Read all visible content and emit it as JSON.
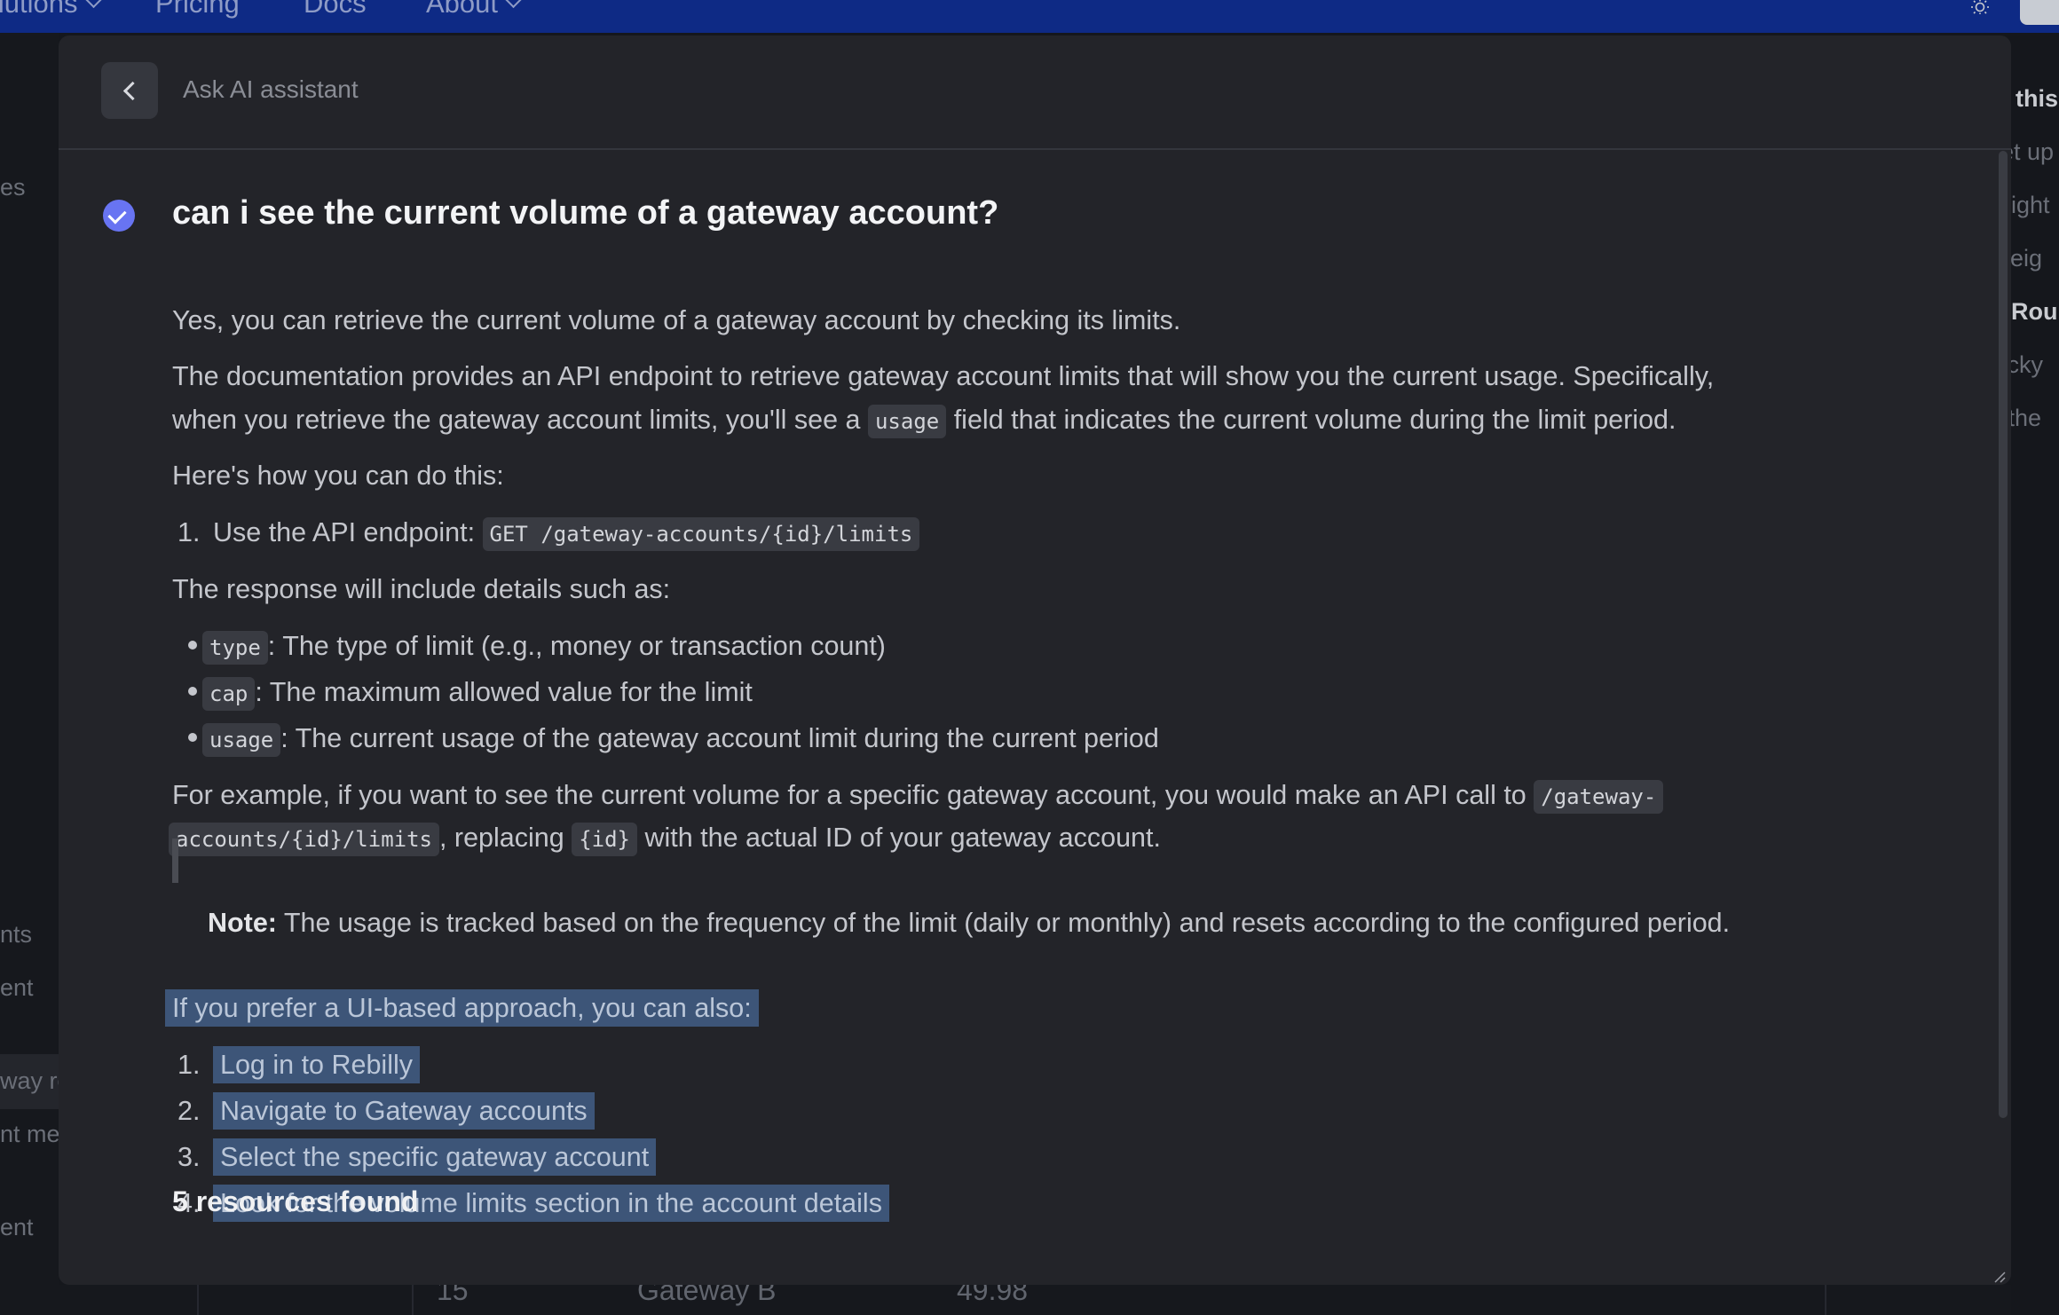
{
  "nav": {
    "solutions_label": "Solutions",
    "pricing_label": "Pricing",
    "docs_label": "Docs",
    "about_label": "About"
  },
  "background": {
    "left_fragments": [
      "es",
      "nts",
      "ent",
      "way ro",
      "nt me",
      "ent"
    ],
    "right_fragments": [
      "On this",
      "Set up",
      "Weight",
      "Weig",
      "Rou",
      "Sticky",
      "Furthe"
    ],
    "table_row": {
      "id": "15",
      "name": "Gateway B",
      "value": "49.98"
    }
  },
  "modal": {
    "header_title": "Ask AI assistant",
    "question": "can i see the current volume of a gateway account?",
    "answer": {
      "intro": "Yes, you can retrieve the current volume of a gateway account by checking its limits.",
      "doc_line1": "The documentation provides an API endpoint to retrieve gateway account limits that will show you the current usage. Specifically,",
      "doc_line2_a": "when you retrieve the gateway account limits, you'll see a ",
      "doc_line2_code": "usage",
      "doc_line2_b": " field that indicates the current volume during the limit period.",
      "howto": "Here's how you can do this:",
      "step1_num": "1.",
      "step1_text": "Use the API endpoint: ",
      "step1_code": "GET /gateway-accounts/{id}/limits",
      "response_intro": "The response will include details such as:",
      "details": [
        {
          "code": "type",
          "text": ": The type of limit (e.g., money or transaction count)"
        },
        {
          "code": "cap",
          "text": ": The maximum allowed value for the limit"
        },
        {
          "code": "usage",
          "text": ": The current usage of the gateway account limit during the current period"
        }
      ],
      "example_line1_a": "For example, if you want to see the current volume for a specific gateway account, you would make an API call to ",
      "example_line1_code": "/gateway-",
      "example_line2_code": "accounts/{id}/limits",
      "example_line2_b": ", replacing ",
      "example_line2_code2": "{id}",
      "example_line2_c": " with the actual ID of your gateway account.",
      "note_label": "Note:",
      "note_text": " The usage is tracked based on the frequency of the limit (daily or monthly) and resets according to the configured period.",
      "ui_intro": "If you prefer a UI-based approach, you can also:",
      "ui_steps": [
        {
          "num": "1.",
          "text": "Log in to Rebilly"
        },
        {
          "num": "2.",
          "text": "Navigate to Gateway accounts"
        },
        {
          "num": "3.",
          "text": "Select the specific gateway account"
        },
        {
          "num": "4.",
          "text": "Look for the volume limits section in the account details"
        }
      ]
    },
    "resources_heading": "5 resources found"
  },
  "colors": {
    "nav_bg": "#0e2a85",
    "modal_bg": "#232429",
    "accent": "#6874f2",
    "selection": "#3d5578"
  }
}
